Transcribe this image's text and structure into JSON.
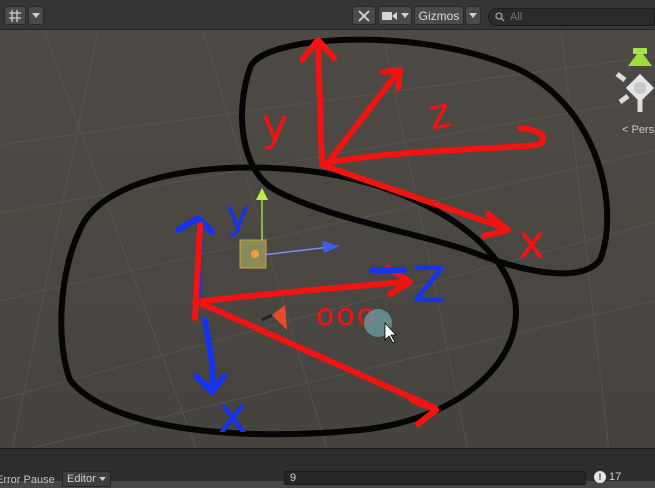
{
  "toolbar": {
    "grid_icon": "grid-icon",
    "tools_icon": "crossed-tools-icon",
    "camera_icon": "camera-icon",
    "gizmos_label": "Gizmos",
    "search_placeholder": "All"
  },
  "scene": {
    "projection_label": "< Persp",
    "annotations": {
      "top_group": {
        "y": "y",
        "z": "z",
        "x": "x"
      },
      "bottom_group": {
        "y": "y",
        "z": "Z",
        "x": "x"
      },
      "scribble": "ooo"
    },
    "colors": {
      "red_ink": "#f21313",
      "blue_ink": "#1633f0",
      "black_ink": "#050505"
    }
  },
  "statusbar": {
    "error_pause": "Error Pause",
    "editor_label": "Editor",
    "console_search": "9",
    "message_count": "17"
  }
}
